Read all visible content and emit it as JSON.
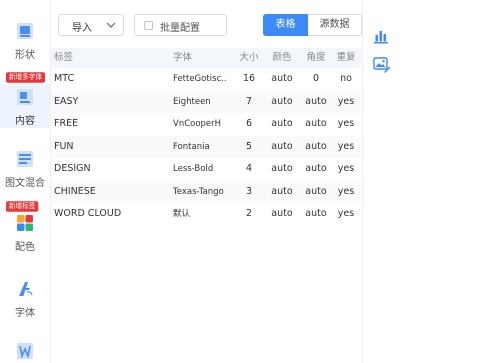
{
  "sidebar": {
    "items": [
      {
        "label": "形状",
        "icon": "shape-icon"
      },
      {
        "label": "内容",
        "icon": "content-icon"
      },
      {
        "label": "图文混合",
        "icon": "image-text-icon"
      },
      {
        "label": "配色",
        "icon": "palette-icon"
      },
      {
        "label": "字体",
        "icon": "font-icon"
      },
      {
        "label": "",
        "icon": "wordcloud-icon"
      }
    ],
    "badges": [
      "新增多字体",
      "新增标签"
    ]
  },
  "toolbar": {
    "import_label": "导入",
    "batch_label": "批量配置",
    "tab_table": "表格",
    "tab_source": "源数据"
  },
  "table": {
    "columns": [
      "标签",
      "字体",
      "大小",
      "颜色",
      "角度",
      "重复"
    ],
    "rows": [
      {
        "label": "MTC",
        "font": "FetteGotisc..",
        "size": "16",
        "color": "auto",
        "angle": "0",
        "repeat": "no"
      },
      {
        "label": "EASY",
        "font": "Eighteen",
        "size": "7",
        "color": "auto",
        "angle": "auto",
        "repeat": "yes"
      },
      {
        "label": "FREE",
        "font": "VnCooperH",
        "size": "6",
        "color": "auto",
        "angle": "auto",
        "repeat": "yes"
      },
      {
        "label": "FUN",
        "font": "Fontania",
        "size": "5",
        "color": "auto",
        "angle": "auto",
        "repeat": "yes"
      },
      {
        "label": "DESIGN",
        "font": "Less-Bold",
        "size": "4",
        "color": "auto",
        "angle": "auto",
        "repeat": "yes"
      },
      {
        "label": "CHINESE",
        "font": "Texas-Tango",
        "size": "3",
        "color": "auto",
        "angle": "auto",
        "repeat": "yes"
      },
      {
        "label": "WORD CLOUD",
        "font": "默认",
        "size": "2",
        "color": "auto",
        "angle": "auto",
        "repeat": "yes"
      }
    ]
  },
  "right_panel": {
    "icons": [
      "bar-chart-icon",
      "image-edit-icon"
    ]
  },
  "colors": {
    "accent": "#3d8af7",
    "badge": "#e4393c",
    "header_bg": "#f3f6fb"
  }
}
